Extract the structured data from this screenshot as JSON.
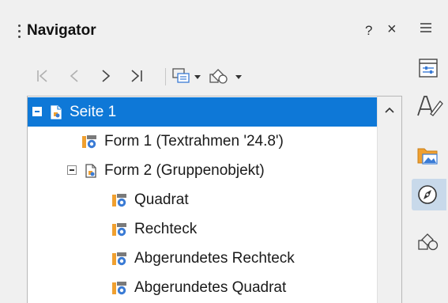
{
  "panel": {
    "title": "Navigator",
    "help_label": "?",
    "close_label": "×"
  },
  "toolbar": {
    "buttons": [
      {
        "name": "first-element-icon",
        "enabled": false
      },
      {
        "name": "previous-element-icon",
        "enabled": false
      },
      {
        "name": "next-element-icon",
        "enabled": true
      },
      {
        "name": "last-element-icon",
        "enabled": true
      },
      {
        "name": "drag-mode-icon",
        "has_dropdown": true
      },
      {
        "name": "shapes-icon",
        "has_dropdown": true
      }
    ]
  },
  "tree": {
    "items": [
      {
        "label": "Seite 1",
        "icon": "page-icon",
        "level": 0,
        "expander": "expanded",
        "selected": true
      },
      {
        "label": "Form 1 (Textrahmen '24.8')",
        "icon": "shape-icon",
        "level": 1,
        "selected": false
      },
      {
        "label": "Form 2 (Gruppenobjekt)",
        "icon": "page-icon",
        "level": 1,
        "expander": "expanded",
        "selected": false
      },
      {
        "label": "Quadrat",
        "icon": "shape-icon",
        "level": 2,
        "selected": false
      },
      {
        "label": "Rechteck",
        "icon": "shape-icon",
        "level": 2,
        "selected": false
      },
      {
        "label": "Abgerundetes Rechteck",
        "icon": "shape-icon",
        "level": 2,
        "selected": false
      },
      {
        "label": "Abgerundetes Quadrat",
        "icon": "shape-icon",
        "level": 2,
        "selected": false
      }
    ]
  },
  "sidebar": {
    "items": [
      {
        "name": "sidebar-menu-icon",
        "active": false
      },
      {
        "name": "properties-icon",
        "active": false
      },
      {
        "name": "styles-icon",
        "active": false
      },
      {
        "name": "gallery-icon",
        "active": false
      },
      {
        "name": "navigator-icon",
        "active": true
      },
      {
        "name": "shapes-icon",
        "active": false
      }
    ]
  },
  "colors": {
    "selection": "#0e78d7",
    "accent_orange": "#f0a030",
    "accent_blue": "#3a7bd5",
    "panel_bg": "#f0f0f0"
  }
}
